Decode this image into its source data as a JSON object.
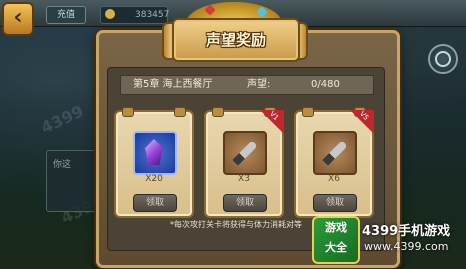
{
  "topbar": {
    "recharge_label": "充值",
    "currency_value": "383457"
  },
  "dialog": {
    "title": "声望奖励",
    "chapter": "第5章  海上西餐厅",
    "reputation_label": "声望:",
    "reputation_value": "0/480",
    "note": "*每次攻打关卡将获得与体力消耗对等"
  },
  "rewards": [
    {
      "icon": "purple-gem-icon",
      "quantity": "X20",
      "claim_label": "领取",
      "tag": ""
    },
    {
      "icon": "dagger-icon",
      "quantity": "X3",
      "claim_label": "领取",
      "tag": "V1"
    },
    {
      "icon": "dagger-icon",
      "quantity": "X6",
      "claim_label": "领取",
      "tag": "V5"
    }
  ],
  "background": {
    "panel_label": "你这"
  },
  "logo": {
    "badge_top": "游戏",
    "badge_bottom": "大全",
    "name": "4399手机游戏",
    "url": "www.4399.com"
  },
  "colors": {
    "dialog_border": "#c8a666",
    "banner": "#e0b660",
    "ribbon": "#c0262b"
  }
}
